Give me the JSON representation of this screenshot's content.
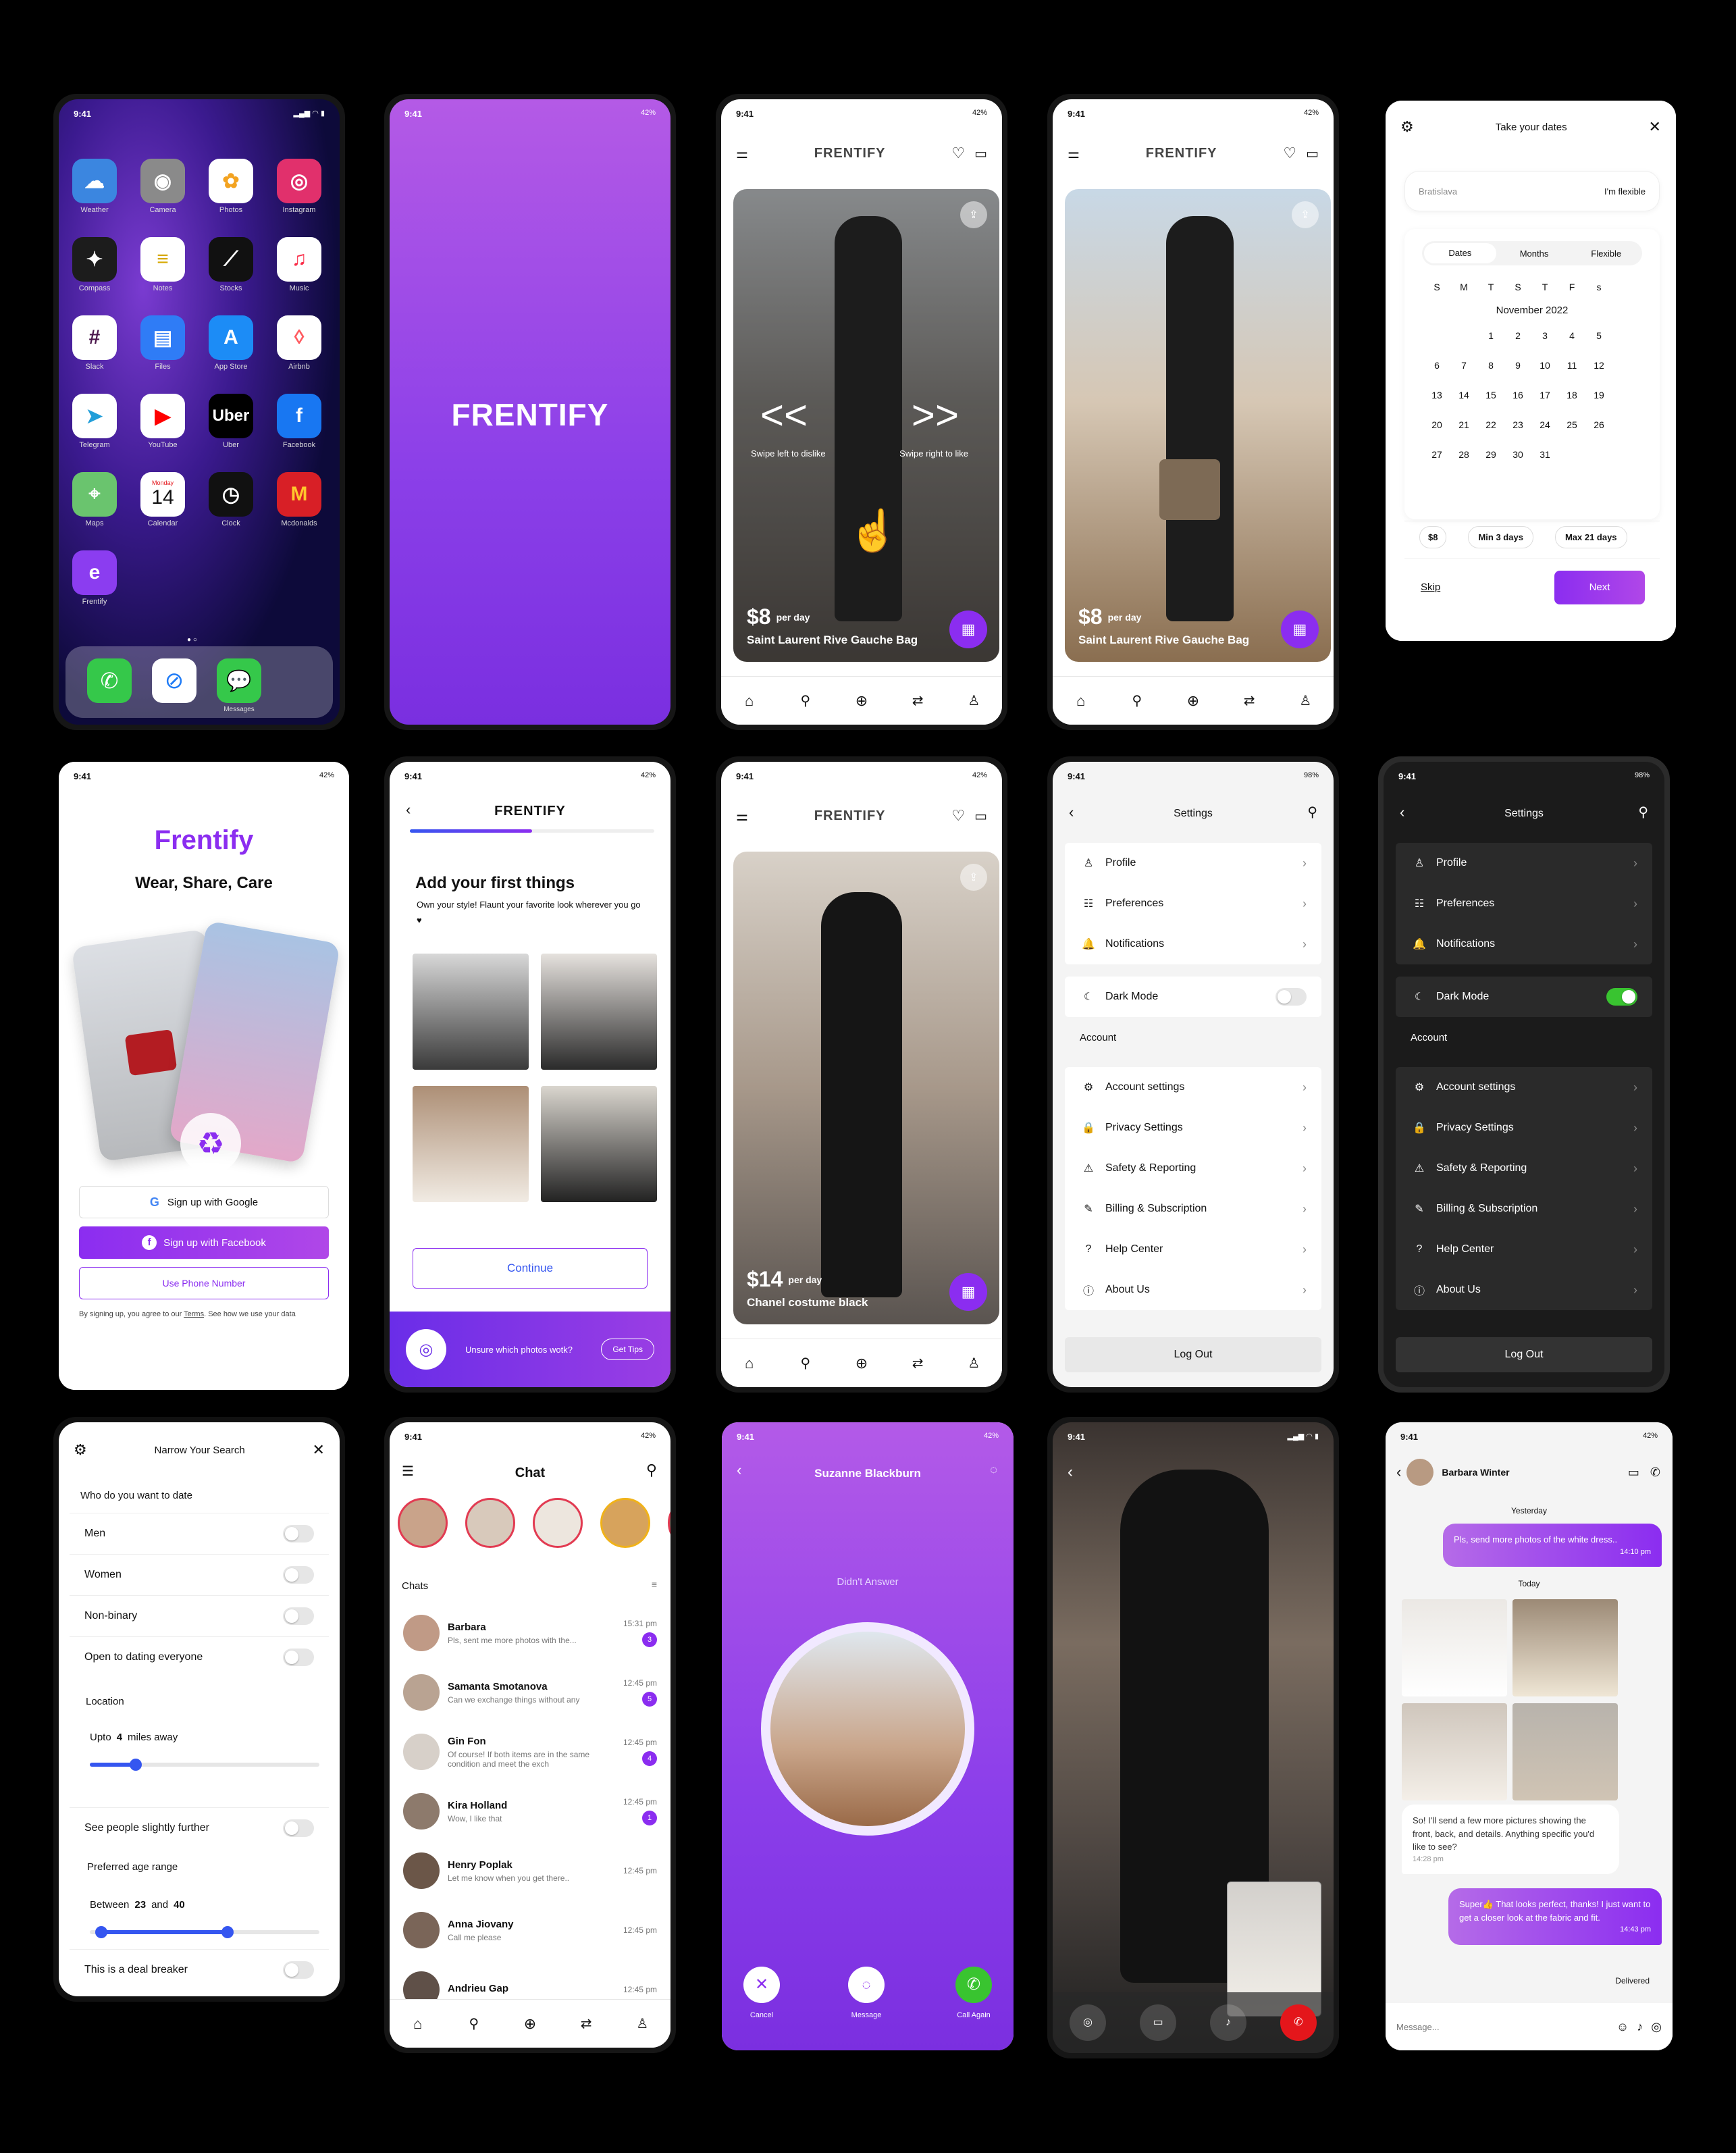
{
  "status_time": "9:41",
  "battery": "42%",
  "battery_98": "98%",
  "home": {
    "apps": [
      {
        "label": "Weather",
        "icon": "weather-icon",
        "color": "#3b86e0"
      },
      {
        "label": "Camera",
        "icon": "camera-icon",
        "color": "#8a8a8a"
      },
      {
        "label": "Photos",
        "icon": "photos-icon",
        "color": "#ffffff"
      },
      {
        "label": "Instagram",
        "icon": "instagram-icon",
        "color": "#e1306c"
      },
      {
        "label": "Compass",
        "icon": "compass-icon",
        "color": "#1c1c1c"
      },
      {
        "label": "Notes",
        "icon": "notes-icon",
        "color": "#ffffff"
      },
      {
        "label": "Stocks",
        "icon": "stocks-icon",
        "color": "#111111"
      },
      {
        "label": "Music",
        "icon": "music-icon",
        "color": "#ffffff"
      },
      {
        "label": "Slack",
        "icon": "slack-icon",
        "color": "#ffffff"
      },
      {
        "label": "Files",
        "icon": "files-icon",
        "color": "#2f7cf6"
      },
      {
        "label": "App Store",
        "icon": "app-store-icon",
        "color": "#1c8cf6"
      },
      {
        "label": "Airbnb",
        "icon": "airbnb-icon",
        "color": "#ffffff"
      },
      {
        "label": "Telegram",
        "icon": "telegram-icon",
        "color": "#ffffff"
      },
      {
        "label": "YouTube",
        "icon": "youtube-icon",
        "color": "#ffffff"
      },
      {
        "label": "Uber",
        "icon": "uber-icon",
        "color": "#000000"
      },
      {
        "label": "Facebook",
        "icon": "facebook-icon",
        "color": "#1877f2"
      },
      {
        "label": "Maps",
        "icon": "maps-icon",
        "color": "#6ac46e"
      },
      {
        "label": "Calendar",
        "icon": "calendar-icon",
        "color": "#ffffff"
      },
      {
        "label": "Clock",
        "icon": "clock-icon",
        "color": "#111111"
      },
      {
        "label": "Mcdonalds",
        "icon": "mcdonalds-icon",
        "color": "#d81f26"
      },
      {
        "label": "Frentify",
        "icon": "frentify-icon",
        "color": "#8b3df0"
      }
    ],
    "calendar_day": "Monday",
    "calendar_date": "14",
    "uber_text": "Uber",
    "dock_label": "Messages"
  },
  "brand": "FRENTIFY",
  "feed1": {
    "swipe_left": "Swipe left to dislike",
    "swipe_right": "Swipe right to like",
    "price": "$8",
    "per_day": "per day",
    "title": "Saint Laurent Rive Gauche Bag"
  },
  "dates": {
    "title": "Take your dates",
    "location": "Bratislava",
    "flexible": "I'm flexible",
    "tabs": [
      "Dates",
      "Months",
      "Flexible"
    ],
    "weekdays": [
      "S",
      "M",
      "T",
      "S",
      "T",
      "F",
      "s"
    ],
    "month": "November 2022",
    "weeks": [
      [
        "",
        "",
        "1",
        "2",
        "3",
        "4",
        "5"
      ],
      [
        "6",
        "7",
        "8",
        "9",
        "10",
        "11",
        "12"
      ],
      [
        "13",
        "14",
        "15",
        "16",
        "17",
        "18",
        "19"
      ],
      [
        "20",
        "21",
        "22",
        "23",
        "24",
        "25",
        "26"
      ],
      [
        "27",
        "28",
        "29",
        "30",
        "31",
        "",
        ""
      ]
    ],
    "chips": [
      "$8",
      "Min 3 days",
      "Max 21 days"
    ],
    "skip": "Skip",
    "next": "Next"
  },
  "signup": {
    "title": "Frentify",
    "tagline": "Wear, Share, Care",
    "google": "Sign up with Google",
    "facebook": "Sign up with Facebook",
    "phone": "Use Phone Number",
    "terms_pre": "By signing up, you agree to our ",
    "terms_link": "Terms",
    "terms_post": ". See how we use your data"
  },
  "add_things": {
    "title": "Add your first things",
    "subtitle": "Own your style! Flaunt your favorite look wherever you go ♥",
    "continue": "Continue",
    "tip": "Unsure which photos wotk?",
    "tips_btn": "Get Tips"
  },
  "feed2": {
    "price": "$14",
    "per_day": "per day",
    "title": "Chanel costume black"
  },
  "settings": {
    "title": "Settings",
    "group1": [
      "Profile",
      "Preferences",
      "Notifications"
    ],
    "dark_mode": "Dark Mode",
    "account_header": "Account",
    "group2": [
      "Account settings",
      "Privacy Settings",
      "Safety & Reporting",
      "Billing & Subscription",
      "Help Center",
      "About Us"
    ],
    "logout": "Log Out"
  },
  "narrow": {
    "title": "Narrow Your Search",
    "who": "Who do you want to date",
    "options": [
      "Men",
      "Women",
      "Non-binary",
      "Open to dating everyone"
    ],
    "location": "Location",
    "upto": "Upto",
    "miles": "4",
    "miles_away": "miles away",
    "distance_fraction": 0.2,
    "further": "See people slightly further",
    "age_range": "Preferred age range",
    "between": "Between",
    "age_min": "23",
    "and": "and",
    "age_max": "40",
    "age_fractions": [
      0.05,
      0.6
    ],
    "dealbreaker": "This is a deal breaker"
  },
  "chat": {
    "title": "Chat",
    "section": "Chats",
    "items": [
      {
        "name": "Barbara",
        "msg": "Pls, sent me more photos with the...",
        "time": "15:31 pm",
        "badge": "3"
      },
      {
        "name": "Samanta Smotanova",
        "msg": "Can we exchange things without any",
        "time": "12:45 pm",
        "badge": "5"
      },
      {
        "name": "Gin Fon",
        "msg": "Of course! If both items are in the same condition and meet the exch",
        "time": "12:45 pm",
        "badge": "4"
      },
      {
        "name": "Kira Holland",
        "msg": "Wow, I like that",
        "time": "12:45 pm",
        "badge": "1"
      },
      {
        "name": "Henry Poplak",
        "msg": "Let me know when you get there..",
        "time": "12:45 pm",
        "badge": ""
      },
      {
        "name": "Anna Jiovany",
        "msg": "Call me please",
        "time": "12:45 pm",
        "badge": ""
      },
      {
        "name": "Andrieu Gap",
        "msg": "",
        "time": "12:45 pm",
        "badge": ""
      }
    ]
  },
  "call": {
    "name": "Suzanne Blackburn",
    "status": "Didn't Answer",
    "cancel": "Cancel",
    "message": "Message",
    "again": "Call Again"
  },
  "dm": {
    "name": "Barbara Winter",
    "yesterday": "Yesterday",
    "msg1": "Pls, send more photos of the white dress..",
    "msg1_time": "14:10 pm",
    "today": "Today",
    "msg2": "So! I'll send a few more pictures showing the front, back, and details. Anything specific you'd like to see?",
    "msg2_time": "14:28 pm",
    "msg3": "Super👍 That looks perfect, thanks! I just want to get a closer look at the fabric and fit.",
    "msg3_time": "14:43 pm",
    "delivered": "Delivered",
    "placeholder": "Message..."
  },
  "colors": {
    "purple": "#8b2df0",
    "purple_light": "#b35ae8",
    "green": "#39c430",
    "red": "#e4161b"
  }
}
